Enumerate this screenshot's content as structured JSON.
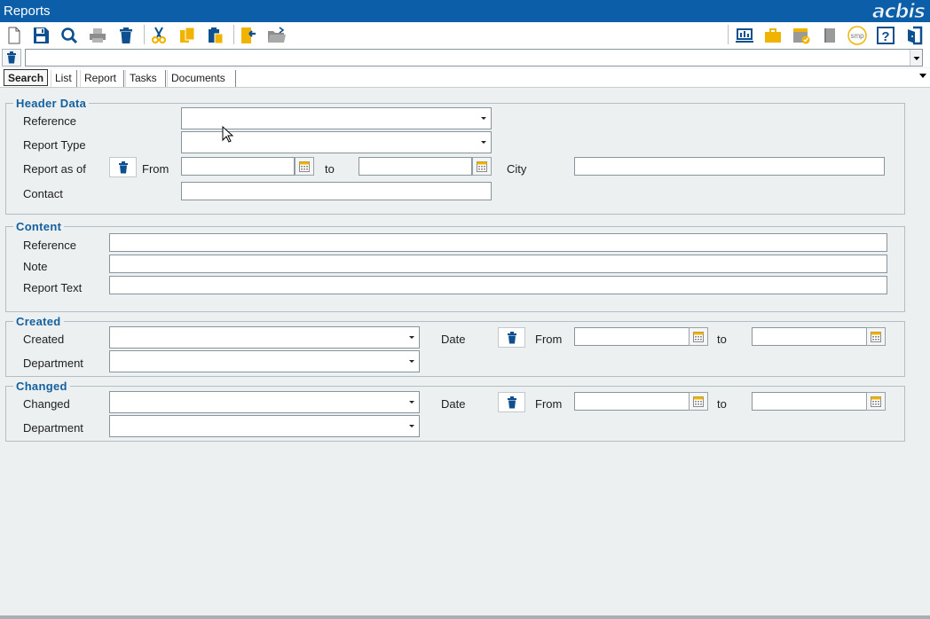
{
  "window": {
    "title": "Reports",
    "logo": "acbis"
  },
  "toolbar": {
    "left": [
      {
        "name": "new-icon"
      },
      {
        "name": "save-icon"
      },
      {
        "name": "search-icon"
      },
      {
        "name": "print-icon"
      },
      {
        "name": "delete-icon"
      },
      {
        "name": "cut-icon"
      },
      {
        "name": "copy-icon"
      },
      {
        "name": "paste-icon"
      },
      {
        "name": "import-icon"
      },
      {
        "name": "open-folder-icon"
      }
    ],
    "right": [
      {
        "name": "monitor-icon"
      },
      {
        "name": "briefcase-icon"
      },
      {
        "name": "calendar-check-icon"
      },
      {
        "name": "book-icon"
      },
      {
        "name": "smp-icon",
        "label": "smp"
      },
      {
        "name": "help-icon",
        "label": "?"
      },
      {
        "name": "exit-icon"
      }
    ]
  },
  "tabs": [
    {
      "label": "Search",
      "active": true
    },
    {
      "label": "List"
    },
    {
      "label": "Report"
    },
    {
      "label": "Tasks"
    },
    {
      "label": "Documents"
    }
  ],
  "header_data": {
    "legend": "Header Data",
    "reference_label": "Reference",
    "report_type_label": "Report Type",
    "report_as_of_label": "Report as of",
    "from_label": "From",
    "to_label": "to",
    "city_label": "City",
    "contact_label": "Contact"
  },
  "content": {
    "legend": "Content",
    "reference_label": "Reference",
    "note_label": "Note",
    "report_text_label": "Report Text"
  },
  "created": {
    "legend": "Created",
    "created_label": "Created",
    "department_label": "Department",
    "date_label": "Date",
    "from_label": "From",
    "to_label": "to"
  },
  "changed": {
    "legend": "Changed",
    "changed_label": "Changed",
    "department_label": "Department",
    "date_label": "Date",
    "from_label": "From",
    "to_label": "to"
  },
  "colors": {
    "accent": "#0d5ea8",
    "legend": "#14609f",
    "background": "#ecf0f1",
    "icon_yellow": "#f0b400",
    "icon_blue": "#0d4f8f"
  }
}
